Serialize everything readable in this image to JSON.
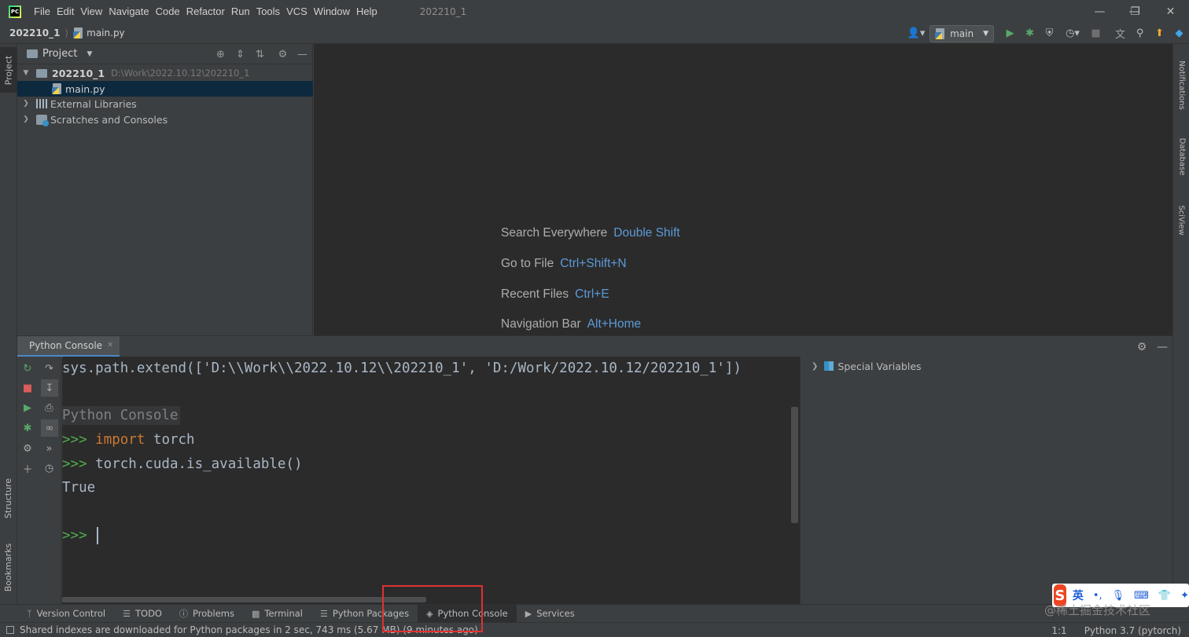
{
  "titlebar": {
    "menus": [
      "File",
      "Edit",
      "View",
      "Navigate",
      "Code",
      "Refactor",
      "Run",
      "Tools",
      "VCS",
      "Window",
      "Help"
    ],
    "window_title": "202210_1",
    "controls": [
      "minimize",
      "maximize",
      "close"
    ]
  },
  "navbar": {
    "project": "202210_1",
    "file": "main.py",
    "run_config": "main"
  },
  "left_stripe": {
    "project": "Project",
    "structure": "Structure",
    "bookmarks": "Bookmarks"
  },
  "right_stripe": {
    "notifications": "Notifications",
    "database": "Database",
    "sciview": "SciView"
  },
  "project_panel": {
    "title": "Project",
    "tree": {
      "root_name": "202210_1",
      "root_path": "D:\\Work\\2022.10.12\\202210_1",
      "file": "main.py",
      "external": "External Libraries",
      "scratches": "Scratches and Consoles"
    }
  },
  "editor_hints": [
    {
      "label": "Search Everywhere",
      "key": "Double Shift"
    },
    {
      "label": "Go to File",
      "key": "Ctrl+Shift+N"
    },
    {
      "label": "Recent Files",
      "key": "Ctrl+E"
    },
    {
      "label": "Navigation Bar",
      "key": "Alt+Home"
    }
  ],
  "console": {
    "tab": "Python Console",
    "line1": "sys.path.extend(['D:\\\\Work\\\\2022.10.12\\\\202210_1', 'D:/Work/2022.10.12/202210_1'])",
    "banner": "Python Console",
    "prompt": ">>>",
    "line2_kw": "import",
    "line2_rest": " torch",
    "line3": " torch.cuda.is_available()",
    "output": "True"
  },
  "variables": {
    "special": "Special Variables"
  },
  "bottom_tabs": {
    "version_control": "Version Control",
    "todo": "TODO",
    "problems": "Problems",
    "terminal": "Terminal",
    "python_packages": "Python Packages",
    "python_console": "Python Console",
    "services": "Services"
  },
  "statusbar": {
    "message": "Shared indexes are downloaded for Python packages in 2 sec, 743 ms (5.67 MB) (9 minutes ago)",
    "position": "1:1",
    "interpreter": "Python 3.7 (pytorch)"
  },
  "overlay": {
    "ime_logo": "S",
    "ime_lang": "英",
    "watermark": "@稀土掘金技术社区"
  },
  "colors": {
    "accent": "#4a88c7",
    "shortcut": "#5c9ad8",
    "prompt": "#4eaa4e",
    "keyword": "#cc7832",
    "highlight": "#e03131"
  }
}
